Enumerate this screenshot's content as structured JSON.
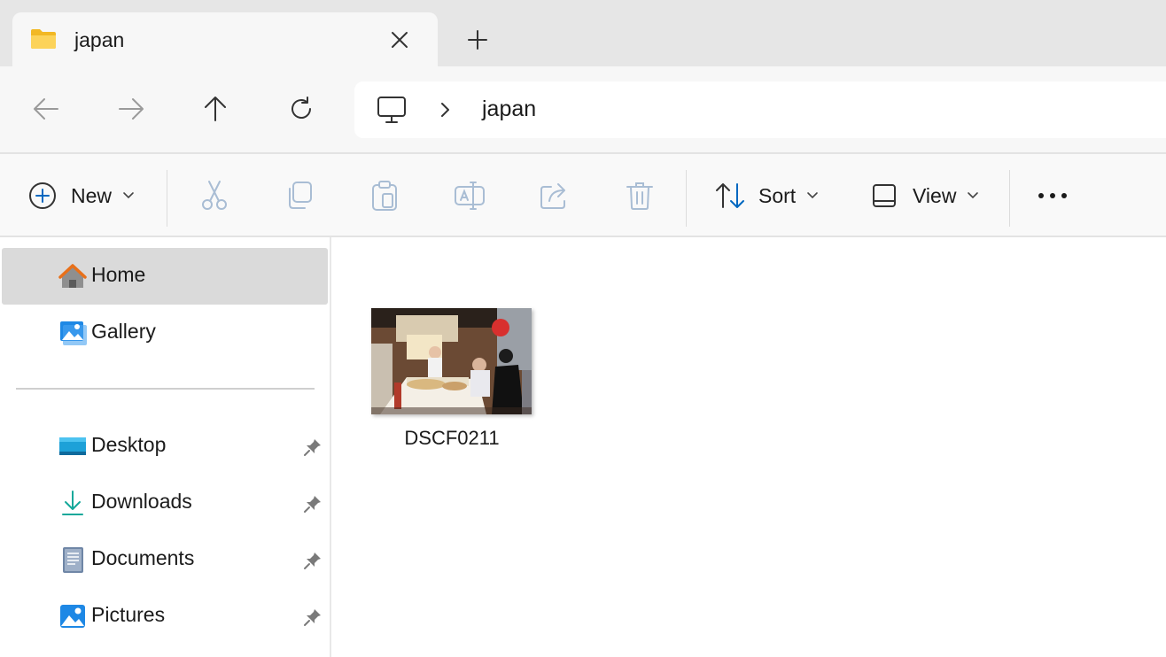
{
  "window": {
    "tab_title": "japan",
    "new_tab_symbol": "+"
  },
  "navigation": {
    "back_icon": "arrow-left-icon",
    "forward_icon": "arrow-right-icon",
    "up_icon": "arrow-up-icon",
    "refresh_icon": "refresh-icon",
    "breadcrumb": [
      "japan"
    ]
  },
  "toolbar": {
    "new_label": "New",
    "sort_label": "Sort",
    "view_label": "View",
    "more_icon": "ellipsis-icon",
    "disabled_actions": [
      "cut-icon",
      "copy-icon",
      "paste-icon",
      "rename-icon",
      "share-icon",
      "delete-icon"
    ]
  },
  "sidebar": {
    "items": [
      {
        "label": "Home",
        "icon": "home-icon",
        "selected": true
      },
      {
        "label": "Gallery",
        "icon": "gallery-icon"
      }
    ],
    "pinned": [
      {
        "label": "Desktop",
        "icon": "desktop-icon"
      },
      {
        "label": "Downloads",
        "icon": "download-icon"
      },
      {
        "label": "Documents",
        "icon": "documents-icon"
      },
      {
        "label": "Pictures",
        "icon": "pictures-icon"
      }
    ]
  },
  "files": [
    {
      "name": "DSCF0211",
      "type": "image"
    }
  ],
  "colors": {
    "accent": "#0067c0",
    "folder_yellow": "#f7c244",
    "selected_bg": "#dadada"
  }
}
